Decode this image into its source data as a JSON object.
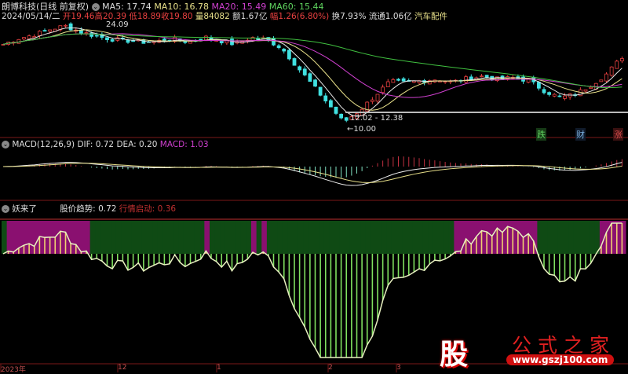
{
  "header": {
    "title": "朗博科技(日线 前复权)",
    "ma5": "MA5: 17.74",
    "ma10": "MA10: 16.78",
    "ma20": "MA20: 15.49",
    "ma60": "MA60: 15.44",
    "date": "2024/05/14/二",
    "open": "开19.46",
    "high": "高20.39",
    "low": "低18.89",
    "close": "收19.80",
    "volume": "量84082",
    "amount": "额1.67亿",
    "change": "幅1.26(6.80%)",
    "turnover": "换7.93%",
    "float": "流通1.06亿",
    "sector": "汽车配件"
  },
  "main": {
    "high_label": "24.09",
    "low_label": "10.00",
    "range_label": "12.02 - 12.38",
    "tags": [
      "跌",
      "财",
      "涨"
    ]
  },
  "macd": {
    "title": "MACD(12,26,9)",
    "dif": "DIF: 0.72",
    "dea": "DEA: 0.20",
    "macd": "MACD: 1.03"
  },
  "indicator": {
    "title": "妖来了",
    "trend": "股价趋势: 0.72",
    "start": "行情启动: 0.36"
  },
  "xaxis": [
    "2023年",
    "12",
    "1",
    "2",
    "3"
  ],
  "watermark": {
    "logo": "股",
    "name": "公式之家",
    "url": "www.gszj100.com"
  },
  "colors": {
    "up": "#e84040",
    "down": "#40e0e0",
    "ma5": "#e8e8e8",
    "ma10": "#e8e08a",
    "ma20": "#d040d0",
    "ma60": "#40c040"
  },
  "chart_data": {
    "type": "candlestick",
    "price_keypoints": [
      21.5,
      22.3,
      22.8,
      23.5,
      24.0,
      23.2,
      22.6,
      22.2,
      22.0,
      21.8,
      21.9,
      22.2,
      21.8,
      22.5,
      22.0,
      21.5,
      22.4,
      22.2,
      21.0,
      18.5,
      16.0,
      13.5,
      11.0,
      12.5,
      14.5,
      16.5,
      16.3,
      16.6,
      16.8,
      16.4,
      16.9,
      17.2,
      16.8,
      17.0,
      16.6,
      15.2,
      14.3,
      14.8,
      16.0,
      17.5,
      19.8
    ],
    "price_range": [
      10.0,
      24.09
    ]
  }
}
